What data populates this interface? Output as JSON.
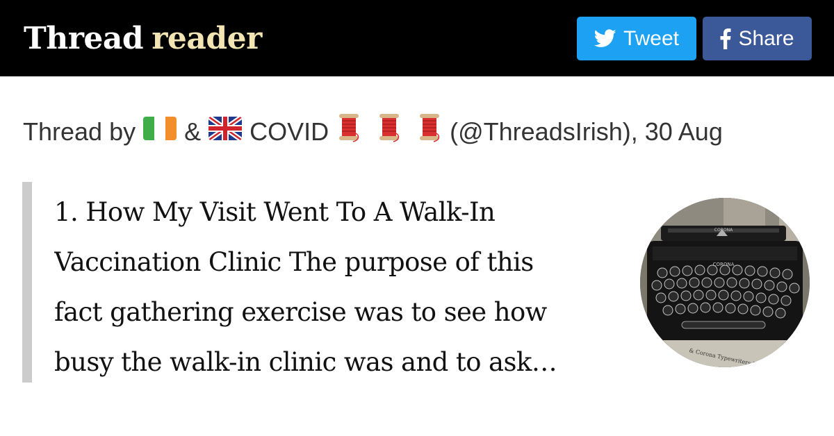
{
  "header": {
    "logo_word1": "Thread",
    "logo_word2": "reader",
    "tweet_label": "Tweet",
    "share_label": "Share"
  },
  "byline": {
    "prefix": "Thread by",
    "amp": "&",
    "covid": "COVID",
    "suffix": "(@ThreadsIrish), 30 Aug"
  },
  "tweet": {
    "lines": [
      "1. How My Visit Went To A Walk-In",
      "Vaccination Clinic The purpose of this",
      "fact gathering exercise was to see how",
      "busy the walk-in clinic was and to ask…"
    ]
  },
  "avatar": {
    "brand_top": "CORONA",
    "brand_front": "CORONA",
    "caption": "& Corona Typewriters Inc."
  },
  "colors": {
    "topbar": "#000000",
    "logo_word2": "#f3e4b4",
    "tweet_button": "#1da1f2",
    "share_button": "#3b5998",
    "quote_bar": "#cccccc"
  },
  "icons": {
    "tweet": "twitter-bird-icon",
    "share": "facebook-f-icon",
    "flag1": "ireland-flag-icon",
    "flag2": "uk-flag-icon",
    "spool": "thread-spool-icon"
  }
}
